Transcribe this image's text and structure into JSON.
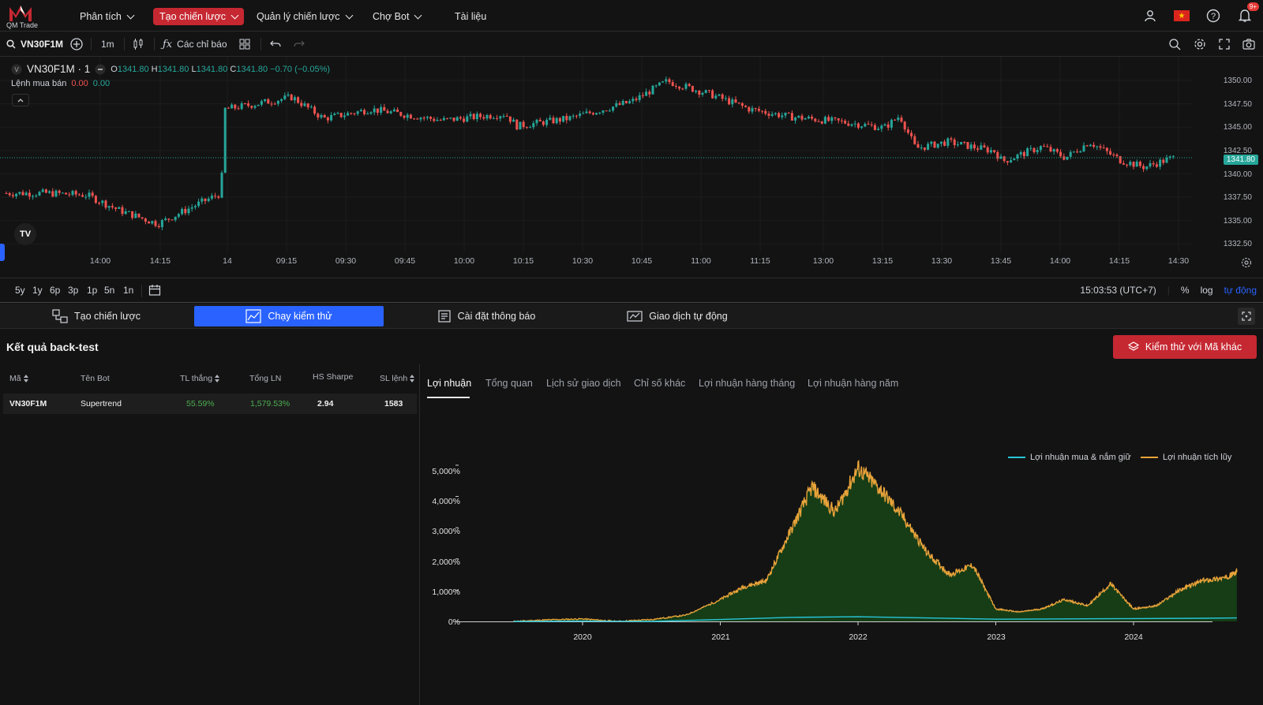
{
  "brand": {
    "name": "QM Trade"
  },
  "nav": {
    "items": [
      {
        "label": "Phân tích",
        "has_menu": true
      },
      {
        "label": "Tạo chiến lược",
        "has_menu": true,
        "active": true
      },
      {
        "label": "Quản lý chiến lược",
        "has_menu": true
      },
      {
        "label": "Chợ Bot",
        "has_menu": true
      },
      {
        "label": "Tài liệu",
        "has_menu": false
      }
    ],
    "notification_badge": "9+"
  },
  "chart_toolbar": {
    "symbol": "VN30F1M",
    "interval": "1m",
    "indicators_label": "Các chỉ báo"
  },
  "chart_legend": {
    "symbol_title": "VN30F1M · 1",
    "o_label": "O",
    "o_value": "1341.80",
    "h_label": "H",
    "h_value": "1341.80",
    "l_label": "L",
    "l_value": "1341.80",
    "c_label": "C",
    "c_value": "1341.80",
    "change": "−0.70 (−0.05%)",
    "order_label": "Lệnh mua bán",
    "order_buy": "0.00",
    "order_sell": "0.00"
  },
  "price_axis": {
    "labels": [
      "1350.00",
      "1347.50",
      "1345.00",
      "1342.50",
      "1340.00",
      "1337.50",
      "1335.00",
      "1332.50"
    ],
    "current_price": "1341.80"
  },
  "time_axis": {
    "labels": [
      "14:00",
      "14:15",
      "14",
      "09:15",
      "09:30",
      "09:45",
      "10:00",
      "10:15",
      "10:30",
      "10:45",
      "11:00",
      "11:15",
      "13:00",
      "13:15",
      "13:30",
      "13:45",
      "14:00",
      "14:15",
      "14:30"
    ]
  },
  "range_bar": {
    "ranges": [
      "5y",
      "1y",
      "6p",
      "3p",
      "1p",
      "5n",
      "1n"
    ],
    "clock": "15:03:53 (UTC+7)",
    "percent": "%",
    "log": "log",
    "auto": "tự động"
  },
  "bottom_tabs": [
    {
      "label": "Tạo chiến lược",
      "active": false
    },
    {
      "label": "Chạy kiểm thử",
      "active": true
    },
    {
      "label": "Cài đặt thông báo",
      "active": false
    },
    {
      "label": "Giao dịch tự động",
      "active": false
    }
  ],
  "results": {
    "title": "Kết quả back-test",
    "other_code_button": "Kiểm thử với Mã khác",
    "columns": [
      "Mã",
      "Tên Bot",
      "TL thắng",
      "Tổng LN",
      "HS Sharpe",
      "SL lệnh"
    ],
    "rows": [
      {
        "code": "VN30F1M",
        "bot": "Supertrend",
        "win_rate": "55.59%",
        "total_profit": "1,579.53%",
        "sharpe": "2.94",
        "orders": "1583"
      }
    ]
  },
  "result_tabs": [
    "Lợi nhuận",
    "Tổng quan",
    "Lịch sử giao dịch",
    "Chỉ số khác",
    "Lợi nhuận hàng tháng",
    "Lợi nhuận hàng năm"
  ],
  "colors": {
    "accent_red": "#c62832",
    "accent_blue": "#2962ff",
    "up": "#26a69a",
    "down": "#ef5350",
    "cumulative": "#e8a33a",
    "buy_hold": "#26c6da"
  },
  "chart_data": {
    "type": "area",
    "title": "",
    "xlabel": "",
    "ylabel": "",
    "x_ticks": [
      "2020",
      "2021",
      "2022",
      "2023",
      "2024"
    ],
    "y_ticks": [
      "0%",
      "1,000%",
      "2,000%",
      "3,000%",
      "4,000%",
      "5,000%"
    ],
    "ylim": [
      0,
      5200
    ],
    "legend_position": "top-right",
    "series": [
      {
        "name": "Lợi nhuận mua & nắm giữ",
        "x": [
          "2019-07",
          "2020-01",
          "2020-07",
          "2021-01",
          "2021-07",
          "2022-01",
          "2022-07",
          "2023-01",
          "2023-07",
          "2024-01",
          "2024-07",
          "2024-10"
        ],
        "values": [
          0,
          10,
          0,
          60,
          130,
          150,
          110,
          70,
          80,
          90,
          100,
          110
        ]
      },
      {
        "name": "Lợi nhuận tích lũy",
        "x": [
          "2019-07",
          "2019-10",
          "2020-01",
          "2020-04",
          "2020-07",
          "2020-10",
          "2021-01",
          "2021-03",
          "2021-05",
          "2021-07",
          "2021-09",
          "2021-11",
          "2022-01",
          "2022-03",
          "2022-05",
          "2022-07",
          "2022-09",
          "2022-11",
          "2023-01",
          "2023-03",
          "2023-05",
          "2023-07",
          "2023-09",
          "2023-11",
          "2024-01",
          "2024-03",
          "2024-05",
          "2024-07",
          "2024-09",
          "2024-10"
        ],
        "values": [
          0,
          50,
          80,
          0,
          60,
          200,
          700,
          1100,
          1300,
          2800,
          4300,
          3500,
          4900,
          4200,
          3300,
          2200,
          1500,
          1800,
          400,
          300,
          400,
          700,
          500,
          1200,
          400,
          500,
          1000,
          1300,
          1400,
          1580
        ]
      }
    ]
  }
}
